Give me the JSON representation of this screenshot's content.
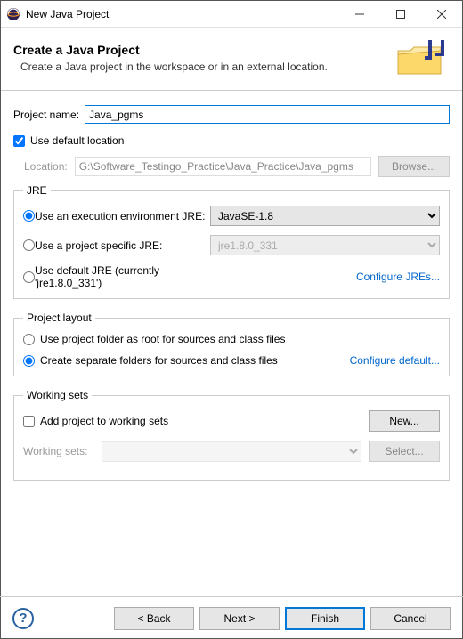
{
  "window": {
    "title": "New Java Project"
  },
  "banner": {
    "heading": "Create a Java Project",
    "subheading": "Create a Java project in the workspace or in an external location."
  },
  "project_name": {
    "label": "Project name:",
    "value": "Java_pgms"
  },
  "location": {
    "use_default_label": "Use default location",
    "label": "Location:",
    "value": "G:\\Software_Testingo_Practice\\Java_Practice\\Java_pgms",
    "browse_label": "Browse..."
  },
  "jre": {
    "legend": "JRE",
    "opt_exec_env_label": "Use an execution environment JRE:",
    "exec_env_value": "JavaSE-1.8",
    "opt_project_specific_label": "Use a project specific JRE:",
    "project_specific_value": "jre1.8.0_331",
    "opt_default_label": "Use default JRE (currently 'jre1.8.0_331')",
    "configure_link": "Configure JREs..."
  },
  "project_layout": {
    "legend": "Project layout",
    "opt_root_label": "Use project folder as root for sources and class files",
    "opt_separate_label": "Create separate folders for sources and class files",
    "configure_link": "Configure default..."
  },
  "working_sets": {
    "legend": "Working sets",
    "add_label": "Add project to working sets",
    "new_label": "New...",
    "ws_label": "Working sets:",
    "select_label": "Select..."
  },
  "buttons": {
    "back": "< Back",
    "next": "Next >",
    "finish": "Finish",
    "cancel": "Cancel"
  }
}
